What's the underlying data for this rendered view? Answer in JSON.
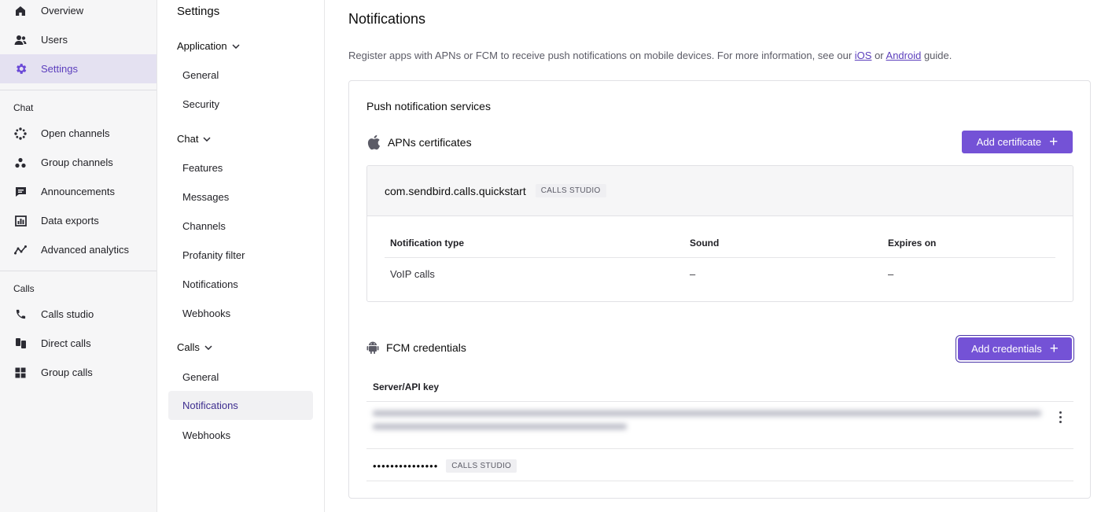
{
  "leftnav": {
    "items_top": [
      {
        "label": "Overview",
        "icon": "home-icon"
      },
      {
        "label": "Users",
        "icon": "users-icon"
      },
      {
        "label": "Settings",
        "icon": "gear-icon",
        "active": true
      }
    ],
    "chat_section": "Chat",
    "chat_items": [
      {
        "label": "Open channels",
        "icon": "open-channels-icon"
      },
      {
        "label": "Group channels",
        "icon": "group-channels-icon"
      },
      {
        "label": "Announcements",
        "icon": "announcements-icon"
      },
      {
        "label": "Data exports",
        "icon": "data-exports-icon"
      },
      {
        "label": "Advanced analytics",
        "icon": "analytics-icon"
      }
    ],
    "calls_section": "Calls",
    "calls_items": [
      {
        "label": "Calls studio",
        "icon": "phone-icon"
      },
      {
        "label": "Direct calls",
        "icon": "direct-calls-icon"
      },
      {
        "label": "Group calls",
        "icon": "grid-icon"
      }
    ],
    "active_color": "#5c3fbd"
  },
  "settings": {
    "title": "Settings",
    "groups": [
      {
        "label": "Application",
        "items": [
          "General",
          "Security"
        ]
      },
      {
        "label": "Chat",
        "items": [
          "Features",
          "Messages",
          "Channels",
          "Profanity filter",
          "Notifications",
          "Webhooks"
        ]
      },
      {
        "label": "Calls",
        "items": [
          "General",
          "Notifications",
          "Webhooks"
        ],
        "active_item": "Notifications"
      }
    ]
  },
  "main": {
    "title": "Notifications",
    "description": {
      "prefix": "Register apps with APNs or FCM to receive push notifications on mobile devices. For more information, see our ",
      "link_ios": "iOS",
      "middle": " or ",
      "link_android": "Android",
      "suffix": " guide."
    },
    "card_title": "Push notification services",
    "apns": {
      "title": "APNs certificates",
      "button": "Add certificate",
      "bundle_id": "com.sendbird.calls.quickstart",
      "tag": "CALLS STUDIO",
      "columns": [
        "Notification type",
        "Sound",
        "Expires on"
      ],
      "rows": [
        [
          "VoIP calls",
          "–",
          "–"
        ]
      ]
    },
    "fcm": {
      "title": "FCM credentials",
      "button": "Add credentials",
      "column": "Server/API key",
      "masked_key": "•••••••••••••••",
      "tag": "CALLS STUDIO"
    },
    "accent_color": "#7452d6"
  }
}
